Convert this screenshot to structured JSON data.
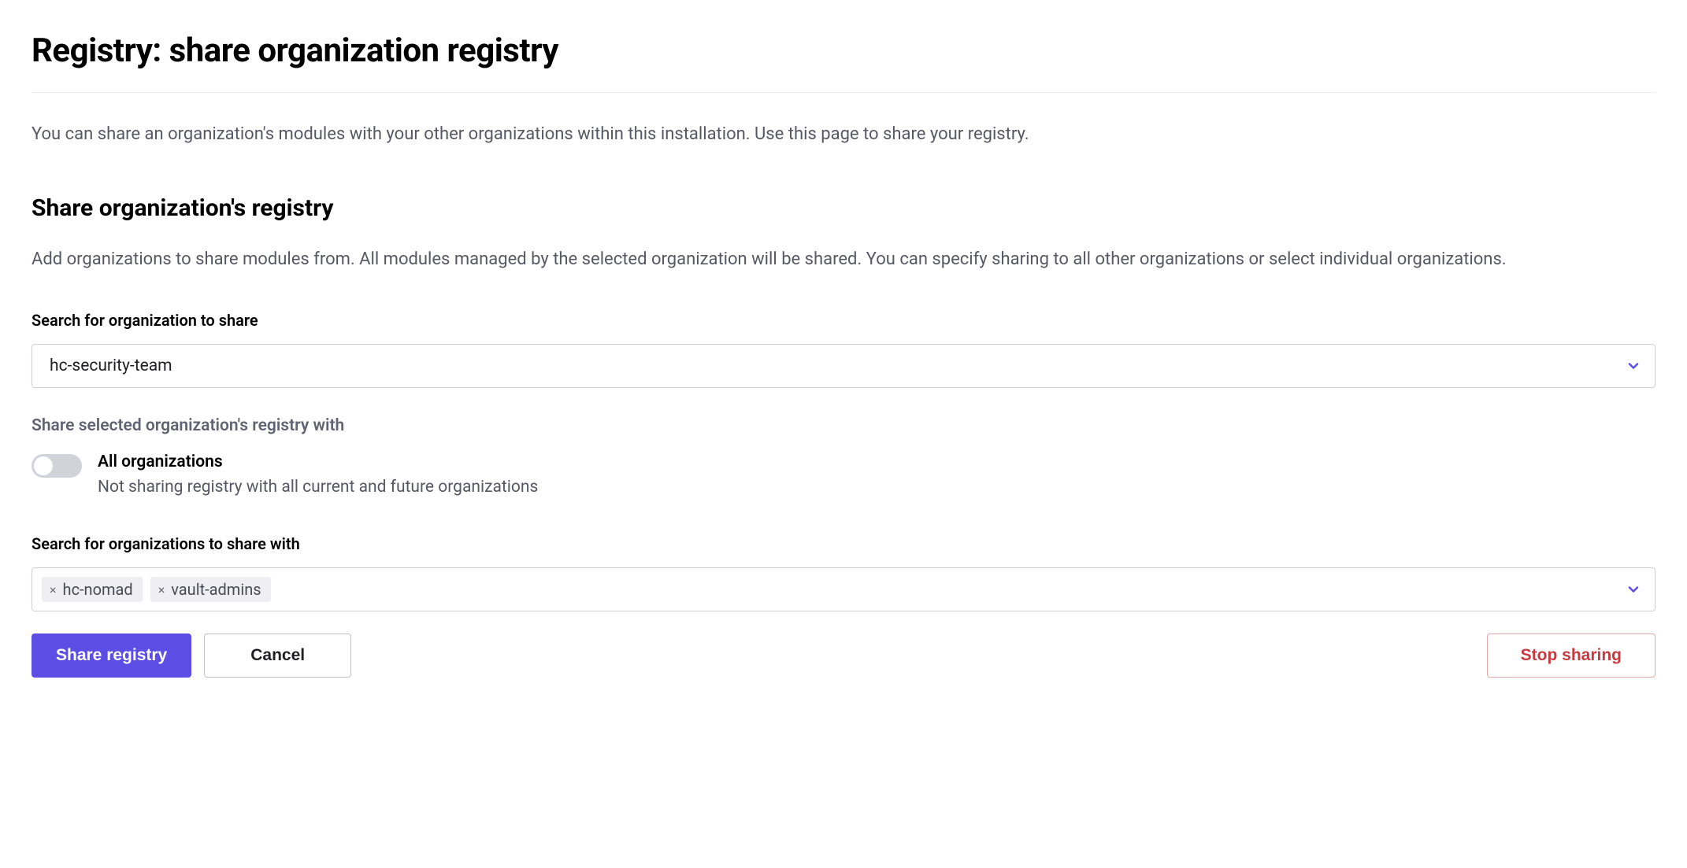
{
  "page": {
    "title": "Registry: share organization registry",
    "description": "You can share an organization's modules with your other organizations within this installation. Use this page to share your registry."
  },
  "section": {
    "title": "Share organization's registry",
    "description": "Add organizations to share modules from. All modules managed by the selected organization will be shared. You can specify sharing to all other organizations or select individual organizations."
  },
  "org_select": {
    "label": "Search for organization to share",
    "value": "hc-security-team"
  },
  "share_with": {
    "label": "Share selected organization's registry with",
    "toggle": {
      "title": "All organizations",
      "description": "Not sharing registry with all current and future organizations",
      "on": false
    }
  },
  "targets": {
    "label": "Search for organizations to share with",
    "selected": [
      "hc-nomad",
      "vault-admins"
    ]
  },
  "buttons": {
    "primary": "Share registry",
    "cancel": "Cancel",
    "stop": "Stop sharing"
  }
}
